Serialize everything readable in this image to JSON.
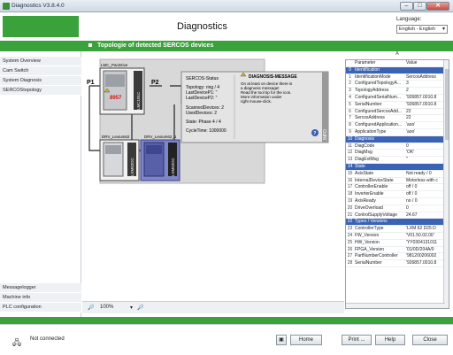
{
  "window": {
    "title": "Diagnostics V3.8.4.0",
    "min": "–",
    "max": "□",
    "close": "✕"
  },
  "header": {
    "title": "Diagnostics",
    "language_label": "Language:",
    "language_value": "English - English"
  },
  "section_title": "Topologie of detected SERCOS devices",
  "sidebar": {
    "top_items": [
      "System Overview",
      "Cam Switch",
      "System Diagnosis",
      "SERCOStopology"
    ],
    "bottom_items": [
      "Messagelogger",
      "Machine info",
      "PLC configuration"
    ]
  },
  "topology": {
    "port_p1": "P1",
    "port_p2": "P2",
    "devices": [
      {
        "name": "LMC_PacDrive",
        "side_label": "LMC101C",
        "error_code": "8957"
      },
      {
        "name": "DRV_Lexium62",
        "side_label": "LXM62DC"
      },
      {
        "name": "DRV_Lexium62_1",
        "side_label": "LXM62DC"
      }
    ],
    "status": {
      "title": "SERCOS-Status",
      "topology": "Topology: ring / 4",
      "last_p1": "LastDeviceP1: \"",
      "last_p2": "LastDeviceP2: \"",
      "scanned": "ScannedDevices: 2",
      "used": "UsedDevices: 2",
      "state": "State: Phase 4 / 4",
      "cycle": "CycleTime: 1000000"
    },
    "message": {
      "title": "DIAGNOSIS-MESSAGE",
      "lines": [
        "On at least on device there is",
        "a diagnosis message!",
        "Read the tool tip for the icon.",
        "More information under",
        "right mouse-click."
      ],
      "side_label": "INFO"
    }
  },
  "zoom": {
    "value": "100%"
  },
  "properties": {
    "column_letter": "A",
    "header": [
      "Parameter",
      "Value"
    ],
    "rows": [
      {
        "n": "0",
        "p": "Identification",
        "v": "",
        "section": true
      },
      {
        "n": "1",
        "p": "IdentificationMode",
        "v": "SercosAddress"
      },
      {
        "n": "2",
        "p": "ConfiguredTopologyA...",
        "v": "3"
      },
      {
        "n": "3",
        "p": "TopologyAddress",
        "v": "2"
      },
      {
        "n": "4",
        "p": "ConfiguredSerialNum...",
        "v": "'926857.0010.8"
      },
      {
        "n": "5",
        "p": "SerialNumber",
        "v": "'926857.0010.8"
      },
      {
        "n": "6",
        "p": "ConfiguredSercosAdd...",
        "v": "22"
      },
      {
        "n": "7",
        "p": "SercosAddress",
        "v": "22"
      },
      {
        "n": "8",
        "p": "ConfiguredApplication...",
        "v": "'aoo'"
      },
      {
        "n": "9",
        "p": "ApplicationType",
        "v": "'aoo'"
      },
      {
        "n": "10",
        "p": "Diagnosis",
        "v": "",
        "section": true
      },
      {
        "n": "11",
        "p": "DiagCode",
        "v": "0"
      },
      {
        "n": "12",
        "p": "DiagMsg",
        "v": "'OK'"
      },
      {
        "n": "13",
        "p": "DiagExtMsg",
        "v": "''"
      },
      {
        "n": "14",
        "p": "State",
        "v": "",
        "section": true
      },
      {
        "n": "15",
        "p": "AxisState",
        "v": "Not ready / 0"
      },
      {
        "n": "16",
        "p": "InternalDeviceState",
        "v": "Motorless with c"
      },
      {
        "n": "17",
        "p": "ControllerEnable",
        "v": "off / 0"
      },
      {
        "n": "18",
        "p": "InverterEnable",
        "v": "off / 0"
      },
      {
        "n": "19",
        "p": "AxisReady",
        "v": "no / 0"
      },
      {
        "n": "20",
        "p": "DriveOverload",
        "v": "0"
      },
      {
        "n": "21",
        "p": "ControlSupplyVoltage",
        "v": "24.67"
      },
      {
        "n": "22",
        "p": "Types / Versions",
        "v": "",
        "section": true
      },
      {
        "n": "23",
        "p": "ControllerType",
        "v": "'LXM 62 D25 D"
      },
      {
        "n": "24",
        "p": "FW_Version",
        "v": "'V01.50.02.00'"
      },
      {
        "n": "25",
        "p": "HW_Version",
        "v": "'YY0304131011"
      },
      {
        "n": "26",
        "p": "FPGA_Version",
        "v": "'01/0D/204A/0"
      },
      {
        "n": "27",
        "p": "PartNumberController",
        "v": "'981200206002"
      },
      {
        "n": "28",
        "p": "SerialNumber",
        "v": "'926857.0010.8"
      }
    ]
  },
  "status": {
    "connection": "Not connected"
  },
  "buttons": {
    "home": "Home",
    "print": "Print ...",
    "help": "Help",
    "close": "Close"
  }
}
